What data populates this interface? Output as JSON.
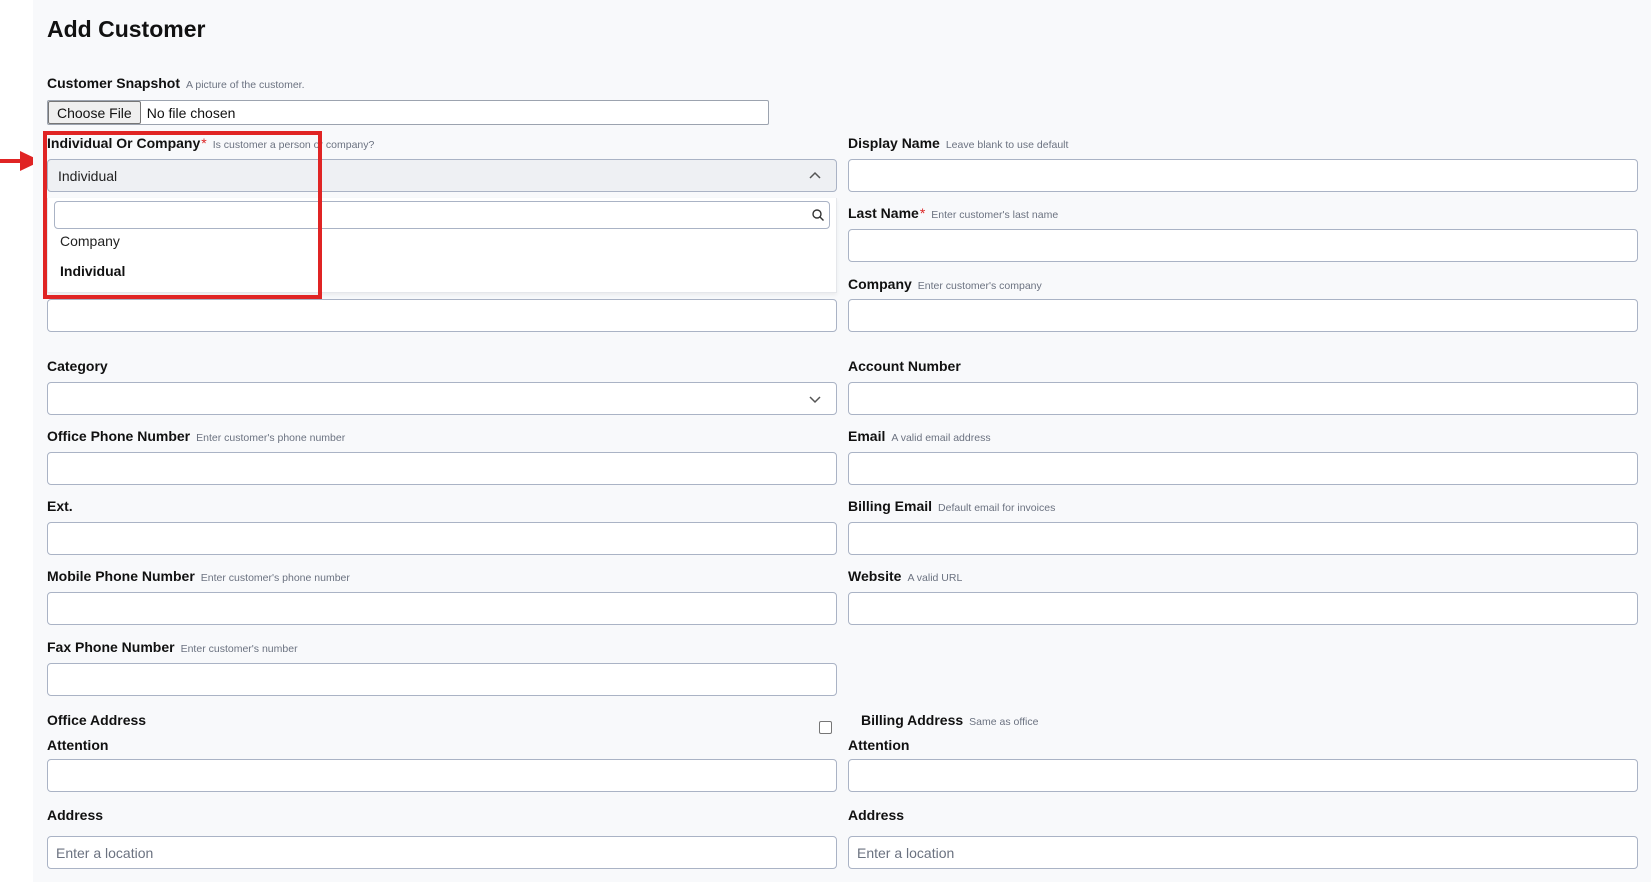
{
  "page_title": "Add Customer",
  "snapshot": {
    "label": "Customer Snapshot",
    "hint": "A picture of the customer.",
    "button": "Choose File",
    "status": "No file chosen"
  },
  "type_field": {
    "label": "Individual Or Company",
    "required": "*",
    "hint": "Is customer a person or company?",
    "selected": "Individual",
    "options": [
      "Company",
      "Individual"
    ]
  },
  "display_name": {
    "label": "Display Name",
    "hint": "Leave blank to use default"
  },
  "last_name": {
    "label": "Last Name",
    "required": "*",
    "hint": "Enter customer's last name"
  },
  "company": {
    "label": "Company",
    "hint": "Enter customer's company"
  },
  "category": {
    "label": "Category"
  },
  "account_number": {
    "label": "Account Number"
  },
  "office_phone": {
    "label": "Office Phone Number",
    "hint": "Enter customer's phone number"
  },
  "email": {
    "label": "Email",
    "hint": "A valid email address"
  },
  "ext": {
    "label": "Ext."
  },
  "billing_email": {
    "label": "Billing Email",
    "hint": "Default email for invoices"
  },
  "mobile_phone": {
    "label": "Mobile Phone Number",
    "hint": "Enter customer's phone number"
  },
  "website": {
    "label": "Website",
    "hint": "A valid URL"
  },
  "fax_phone": {
    "label": "Fax Phone Number",
    "hint": "Enter customer's number"
  },
  "office_address": {
    "heading": "Office Address",
    "attention_label": "Attention",
    "address_label": "Address",
    "address_placeholder": "Enter a location"
  },
  "billing_address": {
    "heading": "Billing Address",
    "hint": "Same as office",
    "attention_label": "Attention",
    "address_label": "Address",
    "address_placeholder": "Enter a location"
  },
  "colors": {
    "highlight": "#e02424",
    "required": "#dc2626",
    "input_border": "#aab3c5",
    "page_bg": "#f8f9fb"
  }
}
